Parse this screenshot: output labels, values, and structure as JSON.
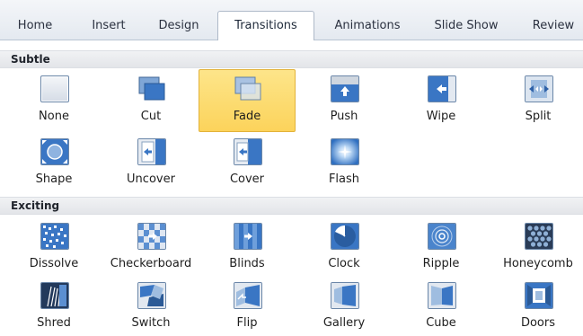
{
  "ribbon": {
    "tabs": [
      {
        "label": "Home",
        "active": false
      },
      {
        "label": "Insert",
        "active": false
      },
      {
        "label": "Design",
        "active": false
      },
      {
        "label": "Transitions",
        "active": true
      },
      {
        "label": "Animations",
        "active": false
      },
      {
        "label": "Slide Show",
        "active": false
      },
      {
        "label": "Review",
        "active": false
      }
    ]
  },
  "gallery": {
    "groups": [
      {
        "title": "Subtle",
        "items": [
          {
            "label": "None",
            "icon": "none-transition-icon",
            "selected": false
          },
          {
            "label": "Cut",
            "icon": "cut-transition-icon",
            "selected": false
          },
          {
            "label": "Fade",
            "icon": "fade-transition-icon",
            "selected": true
          },
          {
            "label": "Push",
            "icon": "push-transition-icon",
            "selected": false
          },
          {
            "label": "Wipe",
            "icon": "wipe-transition-icon",
            "selected": false
          },
          {
            "label": "Split",
            "icon": "split-transition-icon",
            "selected": false
          },
          {
            "label": "Shape",
            "icon": "shape-transition-icon",
            "selected": false
          },
          {
            "label": "Uncover",
            "icon": "uncover-transition-icon",
            "selected": false
          },
          {
            "label": "Cover",
            "icon": "cover-transition-icon",
            "selected": false
          },
          {
            "label": "Flash",
            "icon": "flash-transition-icon",
            "selected": false
          }
        ]
      },
      {
        "title": "Exciting",
        "items": [
          {
            "label": "Dissolve",
            "icon": "dissolve-transition-icon",
            "selected": false
          },
          {
            "label": "Checkerboard",
            "icon": "checkerboard-transition-icon",
            "selected": false
          },
          {
            "label": "Blinds",
            "icon": "blinds-transition-icon",
            "selected": false
          },
          {
            "label": "Clock",
            "icon": "clock-transition-icon",
            "selected": false
          },
          {
            "label": "Ripple",
            "icon": "ripple-transition-icon",
            "selected": false
          },
          {
            "label": "Honeycomb",
            "icon": "honeycomb-transition-icon",
            "selected": false
          },
          {
            "label": "Shred",
            "icon": "shred-transition-icon",
            "selected": false
          },
          {
            "label": "Switch",
            "icon": "switch-transition-icon",
            "selected": false
          },
          {
            "label": "Flip",
            "icon": "flip-transition-icon",
            "selected": false
          },
          {
            "label": "Gallery",
            "icon": "gallery-transition-icon",
            "selected": false
          },
          {
            "label": "Cube",
            "icon": "cube-transition-icon",
            "selected": false
          },
          {
            "label": "Doors",
            "icon": "doors-transition-icon",
            "selected": false
          }
        ]
      }
    ]
  },
  "colors": {
    "selected_fill": "#fcd35b",
    "selected_border": "#e2b23a",
    "icon_blue": "#3a76c4",
    "icon_border": "#6a86a8"
  }
}
